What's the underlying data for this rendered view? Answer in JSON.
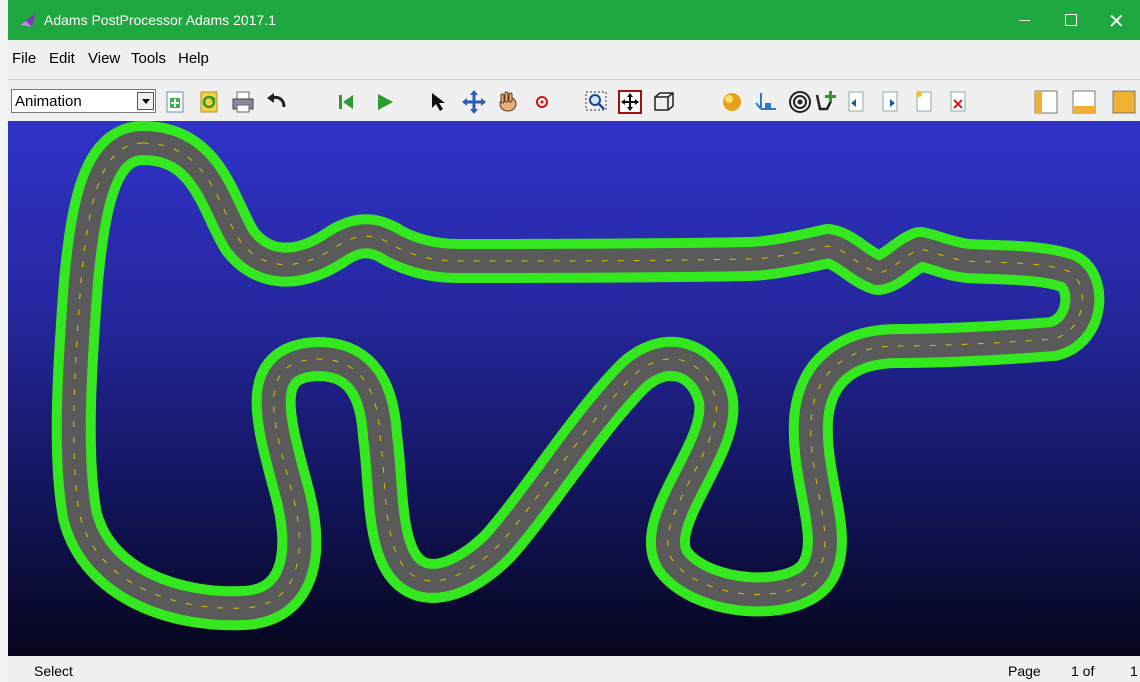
{
  "window": {
    "title": "Adams PostProcessor Adams 2017.1",
    "controls": {
      "minimize_icon": "minimize-icon",
      "maximize_icon": "maximize-icon",
      "close_icon": "close-icon",
      "close_glyph": "✕"
    },
    "accent_color": "#1fa83f"
  },
  "menu": {
    "items": [
      {
        "label": "File"
      },
      {
        "label": "Edit"
      },
      {
        "label": "View"
      },
      {
        "label": "Tools"
      },
      {
        "label": "Help"
      }
    ]
  },
  "toolbar": {
    "mode_select": {
      "value": "Animation"
    },
    "icons": [
      "new-page-icon",
      "reload-icon",
      "print-icon",
      "undo-icon",
      "rewind-icon",
      "play-icon",
      "select-arrow-icon",
      "translate-icon",
      "pan-hand-icon",
      "center-icon",
      "zoom-box-icon",
      "fit-icon",
      "view-box-icon",
      "render-sphere-icon",
      "triad-icon",
      "contact-icon",
      "plot-add-icon",
      "page-prev-icon",
      "page-next-icon",
      "page-new-icon",
      "page-delete-icon",
      "layout-left-icon",
      "layout-bottom-icon",
      "layout-fill-icon"
    ]
  },
  "viewport": {
    "content": "race-track",
    "background_top": "#3032c8",
    "background_bottom": "#05051c",
    "track_border_color": "#33e81e",
    "track_surface_color": "#595959",
    "lane_mark_color": "#e8d000"
  },
  "status": {
    "mode": "Select",
    "page_label": "Page",
    "page_value": "1 of",
    "page_total": "1"
  }
}
